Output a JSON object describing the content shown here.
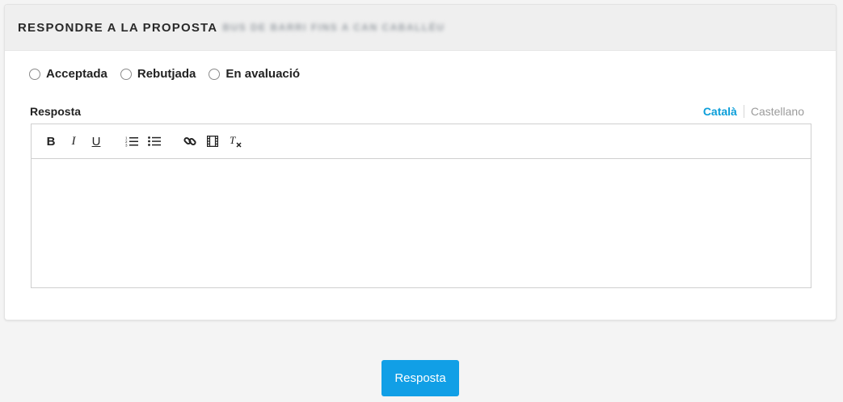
{
  "header": {
    "title": "RESPONDRE A LA PROPOSTA",
    "proposal_name_blurred": "BUS DE BARRI FINS A CAN CABALLÉU"
  },
  "status_options": [
    {
      "label": "Acceptada",
      "selected": false
    },
    {
      "label": "Rebutjada",
      "selected": false
    },
    {
      "label": "En avaluació",
      "selected": false
    }
  ],
  "answer_field": {
    "label": "Resposta",
    "languages": {
      "active": "Català",
      "other": "Castellano"
    },
    "value": ""
  },
  "toolbar": {
    "buttons": [
      "bold-icon",
      "italic-icon",
      "underline-icon",
      "ordered-list-icon",
      "bullet-list-icon",
      "link-icon",
      "video-icon",
      "clear-format-icon"
    ]
  },
  "submit": {
    "label": "Resposta"
  },
  "colors": {
    "accent": "#119fe6",
    "active_tab": "#0b9ed9"
  }
}
